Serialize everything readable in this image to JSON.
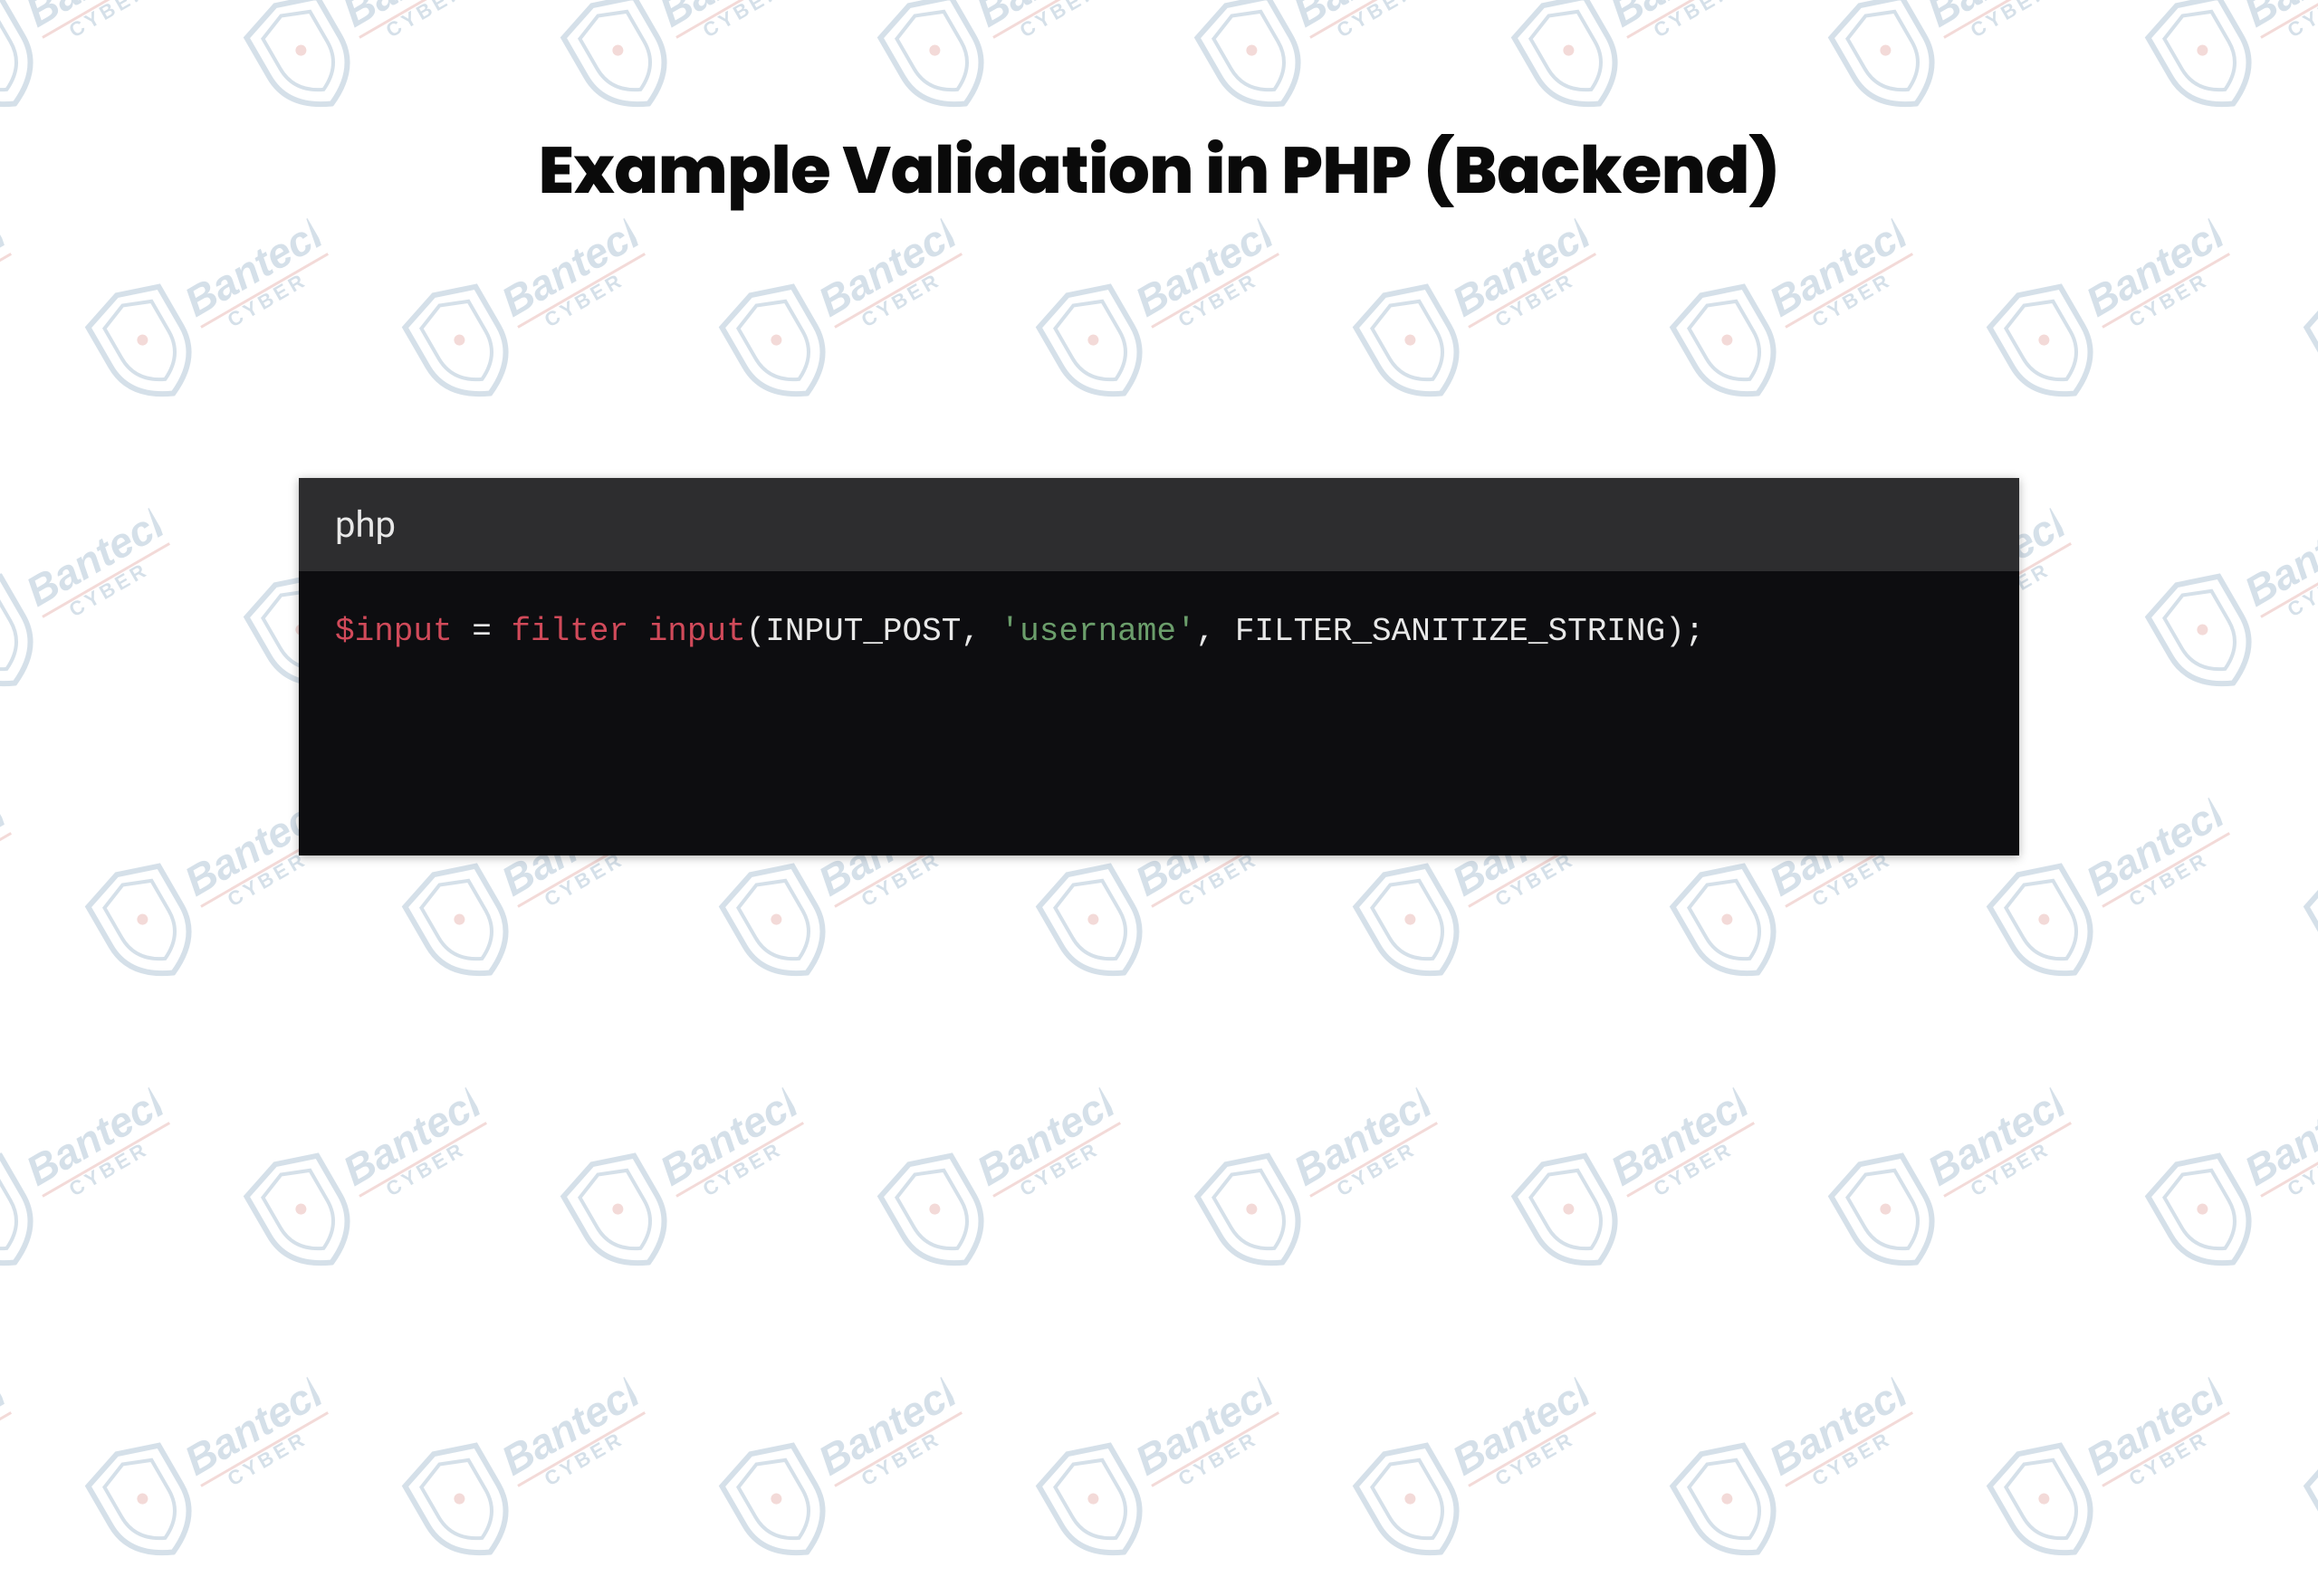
{
  "title": "Example Validation in PHP (Backend)",
  "watermark": {
    "brand_top": "Bantech",
    "brand_bottom": "CYBER"
  },
  "code": {
    "language_label": "php",
    "tokens": {
      "var": "$input",
      "eq": " = ",
      "func": "filter input",
      "open": "(",
      "arg1": "INPUT_POST",
      "comma1": ", ",
      "arg2": "'username'",
      "comma2": ", ",
      "arg3": "FILTER_SANITIZE_STRING",
      "close": ");"
    }
  }
}
